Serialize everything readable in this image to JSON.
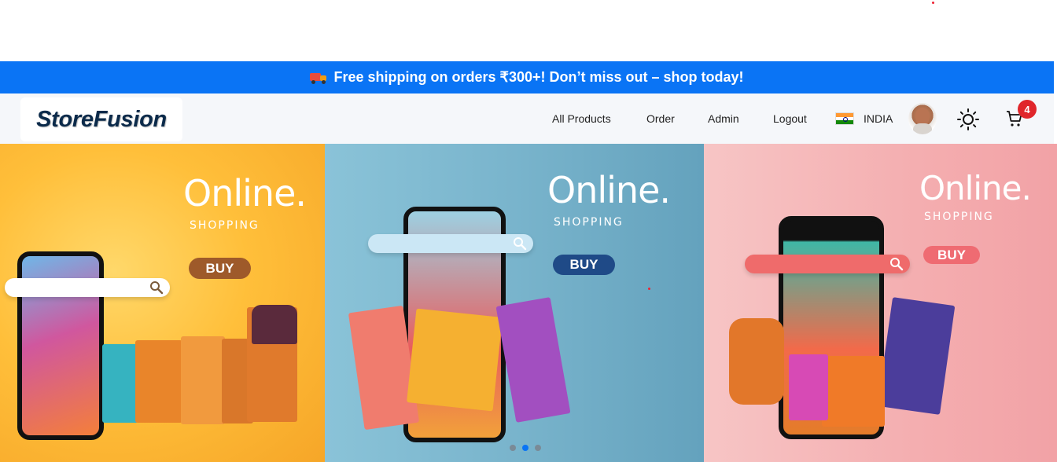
{
  "promo": {
    "icon": "truck-icon",
    "text": "Free shipping on orders ₹300+! Don’t miss out – shop today!"
  },
  "brand": {
    "logo_text": "StoreFusion"
  },
  "nav": {
    "links": [
      "All Products",
      "Order",
      "Admin",
      "Logout"
    ],
    "country": "INDIA",
    "cart_count": "4"
  },
  "hero": {
    "slides": [
      {
        "headline": "Online.",
        "subline": "SHOPPING",
        "cta": "BUY",
        "bg": "#f6a628",
        "cta_color": "#9e5a2a",
        "search_color": "#ffffff"
      },
      {
        "headline": "Online.",
        "subline": "SHOPPING",
        "cta": "BUY",
        "bg": "#79b4cc",
        "cta_color": "#1f4a87",
        "search_color": "#cbe7f5"
      },
      {
        "headline": "Online.",
        "subline": "SHOPPING",
        "cta": "BUY",
        "bg": "#f4aeb0",
        "cta_color": "#ef6b72",
        "search_color": "#ef6b6b"
      }
    ],
    "active_slide": 2
  },
  "colors": {
    "accent": "#0a74f5",
    "badge": "#e0262b",
    "brand_text": "#0b2a4a"
  }
}
